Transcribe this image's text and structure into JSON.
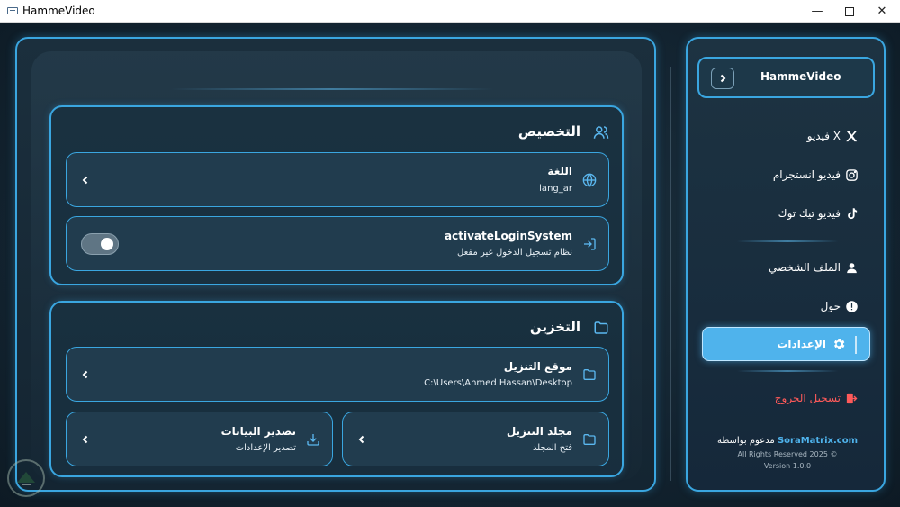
{
  "window": {
    "title": "HammeVideo",
    "minimize": "—",
    "maximize": "",
    "close": "✕"
  },
  "sidebar": {
    "app_name": "HammeVideo",
    "items": [
      {
        "label": "فيديو X",
        "icon": "x-logo-icon"
      },
      {
        "label": "فيديو انستجرام",
        "icon": "instagram-icon"
      },
      {
        "label": "فيديو تيك توك",
        "icon": "tiktok-icon"
      },
      {
        "label": "الملف الشخصي",
        "icon": "user-icon"
      },
      {
        "label": "حول",
        "icon": "info-icon"
      },
      {
        "label": "الإعدادات",
        "icon": "gear-icon",
        "active": true
      },
      {
        "label": "تسجيل الخروج",
        "icon": "logout-icon"
      }
    ],
    "credit_prefix": "مدعوم بواسطة",
    "credit_brand": "SoraMatrix.com",
    "rights": "All Rights Reserved 2025 ©",
    "version": "Version 1.0.0"
  },
  "personalization": {
    "title": "التخصيص",
    "language": {
      "title": "اللغة",
      "value": "lang_ar"
    },
    "login_system": {
      "title": "activateLoginSystem",
      "status": "نظام تسجيل الدخول غير مفعل",
      "enabled": false
    }
  },
  "storage": {
    "title": "التخزين",
    "download_location": {
      "title": "موقع التنزيل",
      "path": "C:\\Users\\Ahmed Hassan\\Desktop"
    },
    "download_folder": {
      "title": "مجلد التنزيل",
      "action": "فتح المجلد"
    },
    "export_data": {
      "title": "تصدير البيانات",
      "action": "تصدير الإعدادات"
    }
  },
  "colors": {
    "accent": "#3aa6e0",
    "active_nav": "#4fb3ec",
    "logout": "#ff5a5a",
    "background": "#132431"
  }
}
